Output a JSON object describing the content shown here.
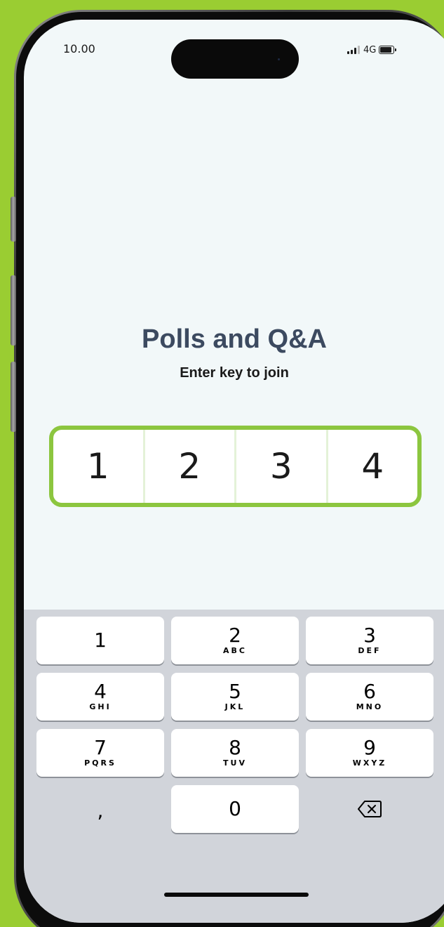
{
  "status_bar": {
    "time": "10.00",
    "network": "4G",
    "battery_level": 0.85
  },
  "main": {
    "title": "Polls and Q&A",
    "subtitle": "Enter key to join",
    "code_digits": [
      "1",
      "2",
      "3",
      "4"
    ],
    "accent_color": "#8cc63f"
  },
  "keyboard": {
    "keys": [
      {
        "digit": "1",
        "letters": ""
      },
      {
        "digit": "2",
        "letters": "ABC"
      },
      {
        "digit": "3",
        "letters": "DEF"
      },
      {
        "digit": "4",
        "letters": "GHI"
      },
      {
        "digit": "5",
        "letters": "JKL"
      },
      {
        "digit": "6",
        "letters": "MNO"
      },
      {
        "digit": "7",
        "letters": "PQRS"
      },
      {
        "digit": "8",
        "letters": "TUV"
      },
      {
        "digit": "9",
        "letters": "WXYZ"
      },
      {
        "digit": "0",
        "letters": ""
      }
    ],
    "comma_label": ",",
    "delete_icon": "backspace-icon"
  }
}
